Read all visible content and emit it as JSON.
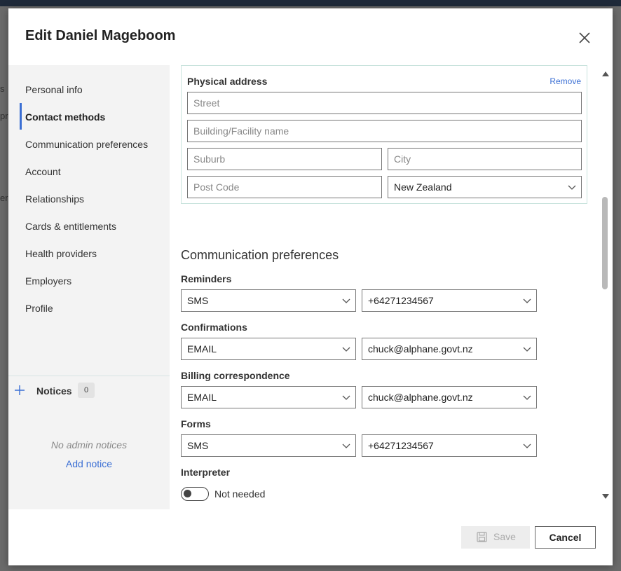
{
  "backdrop": {
    "fragments": [
      "s",
      "pr",
      "er"
    ]
  },
  "dialog": {
    "title": "Edit Daniel Mageboom",
    "close_icon": "close-icon"
  },
  "sidebar": {
    "items": [
      {
        "label": "Personal info",
        "active": false
      },
      {
        "label": "Contact methods",
        "active": true
      },
      {
        "label": "Communication preferences",
        "active": false
      },
      {
        "label": "Account",
        "active": false
      },
      {
        "label": "Relationships",
        "active": false
      },
      {
        "label": "Cards & entitlements",
        "active": false
      },
      {
        "label": "Health providers",
        "active": false
      },
      {
        "label": "Employers",
        "active": false
      },
      {
        "label": "Profile",
        "active": false
      }
    ],
    "notices": {
      "label": "Notices",
      "count": "0",
      "empty_text": "No admin notices",
      "add_label": "Add notice"
    }
  },
  "physical_address": {
    "label": "Physical address",
    "remove_label": "Remove",
    "street_placeholder": "Street",
    "building_placeholder": "Building/Facility name",
    "suburb_placeholder": "Suburb",
    "city_placeholder": "City",
    "postcode_placeholder": "Post Code",
    "country": "New Zealand"
  },
  "communication": {
    "title": "Communication preferences",
    "rows": [
      {
        "label": "Reminders",
        "method": "SMS",
        "contact": "+64271234567"
      },
      {
        "label": "Confirmations",
        "method": "EMAIL",
        "contact": "chuck@alphane.govt.nz"
      },
      {
        "label": "Billing correspondence",
        "method": "EMAIL",
        "contact": "chuck@alphane.govt.nz"
      },
      {
        "label": "Forms",
        "method": "SMS",
        "contact": "+64271234567"
      }
    ],
    "interpreter": {
      "label": "Interpreter",
      "toggle_label": "Not needed",
      "enabled": false
    }
  },
  "footer": {
    "save_label": "Save",
    "cancel_label": "Cancel"
  },
  "colors": {
    "accent": "#3b6fd4",
    "address_border": "#c8e3dd"
  }
}
